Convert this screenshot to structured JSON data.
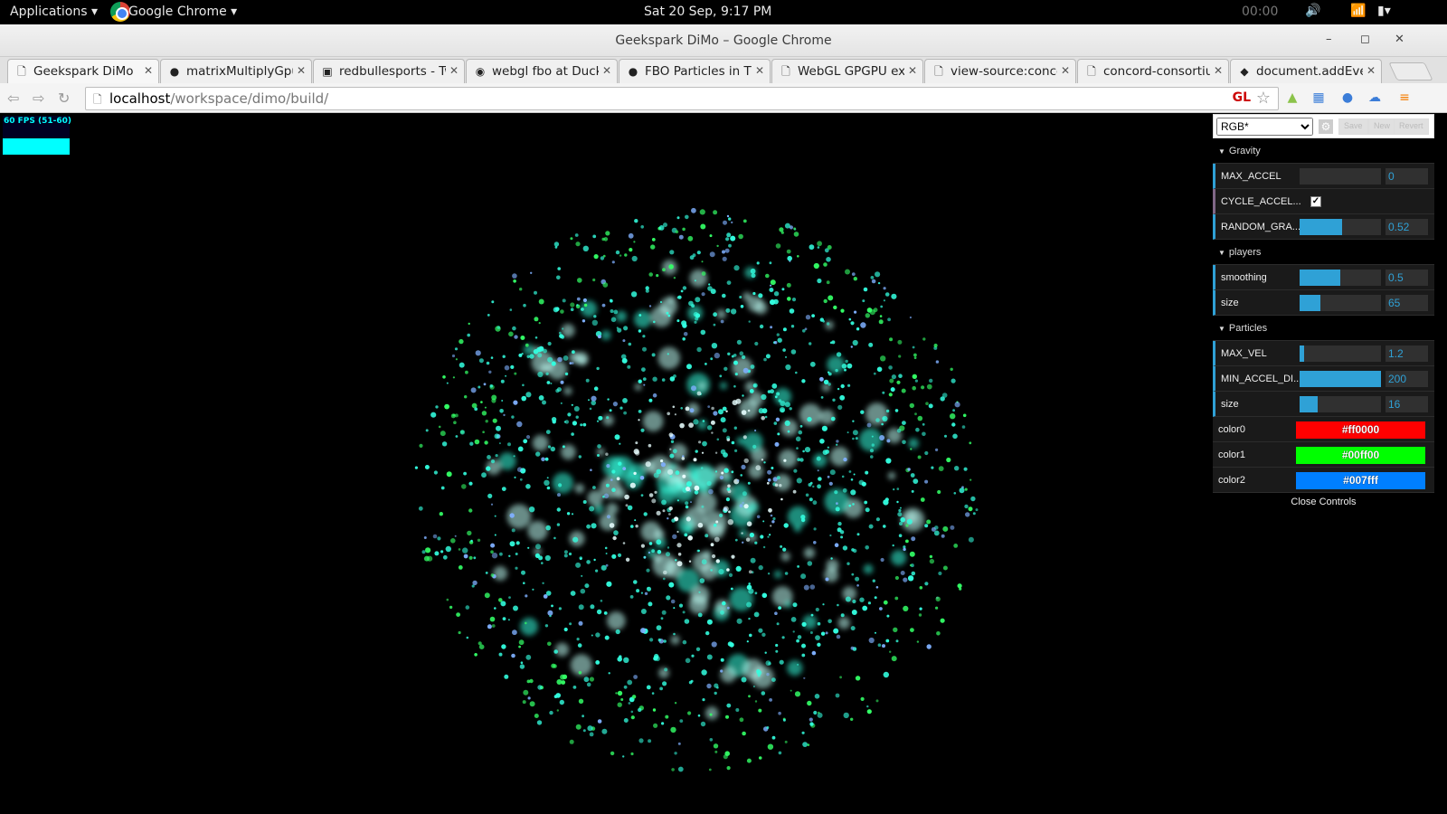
{
  "topbar": {
    "applications": "Applications ▾",
    "app_name": "Google Chrome ▾",
    "clock": "Sat 20 Sep,  9:17 PM",
    "timer": "00:00"
  },
  "window": {
    "title": "Geekspark DiMo – Google Chrome"
  },
  "tabs": [
    {
      "label": "Geekspark DiMo",
      "icon": "page-icon"
    },
    {
      "label": "matrixMultiplyGpu",
      "icon": "github-icon"
    },
    {
      "label": "redbullesports - Tw",
      "icon": "twitch-icon"
    },
    {
      "label": "webgl fbo at Duck",
      "icon": "duckduckgo-icon"
    },
    {
      "label": "FBO Particles in Th",
      "icon": "github-icon"
    },
    {
      "label": "WebGL GPGPU exp",
      "icon": "page-icon"
    },
    {
      "label": "view-source:conco",
      "icon": "page-icon"
    },
    {
      "label": "concord-consortiur",
      "icon": "page-icon"
    },
    {
      "label": "document.addEven",
      "icon": "mdn-icon"
    }
  ],
  "omnibox": {
    "host": "localhost",
    "path": "/workspace/dimo/build/",
    "gl_badge": "GL"
  },
  "stats": {
    "fps_text": "60 FPS (51-60)",
    "fps": 60
  },
  "gui": {
    "preset": "RGB*",
    "save_label": "Save",
    "new_label": "New",
    "revert_label": "Revert",
    "close_label": "Close Controls",
    "folders": {
      "gravity": {
        "title": "Gravity",
        "max_accel": {
          "label": "MAX_ACCEL",
          "value": "0",
          "fraction": 0.0
        },
        "cycle_accel": {
          "label": "CYCLE_ACCEL...",
          "checked": true
        },
        "random_grav": {
          "label": "RANDOM_GRA...",
          "value": "0.52",
          "fraction": 0.52
        }
      },
      "players": {
        "title": "players",
        "smoothing": {
          "label": "smoothing",
          "value": "0.5",
          "fraction": 0.5
        },
        "size": {
          "label": "size",
          "value": "65",
          "fraction": 0.25
        }
      },
      "particles": {
        "title": "Particles",
        "max_vel": {
          "label": "MAX_VEL",
          "value": "1.2",
          "fraction": 0.06
        },
        "min_accel_dist": {
          "label": "MIN_ACCEL_DI...",
          "value": "200",
          "fraction": 1.0
        },
        "size": {
          "label": "size",
          "value": "16",
          "fraction": 0.22
        },
        "color0": {
          "label": "color0",
          "value": "#ff0000"
        },
        "color1": {
          "label": "color1",
          "value": "#00ff00"
        },
        "color2": {
          "label": "color2",
          "value": "#007fff"
        }
      }
    }
  },
  "colors": {
    "gui_accent": "#2fa1d6",
    "particle_cyan": "#33ffe0",
    "particle_green": "#33ff66"
  }
}
